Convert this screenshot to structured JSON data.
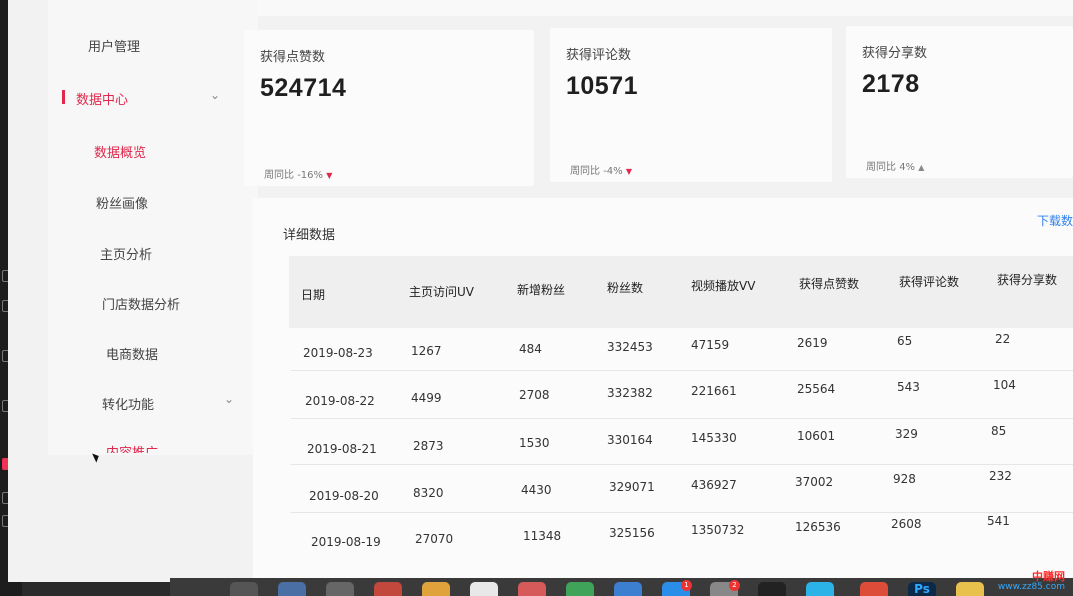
{
  "sidebar": {
    "items": [
      {
        "label": "用户管理"
      },
      {
        "label": "数据中心"
      },
      {
        "label": "数据概览"
      },
      {
        "label": "粉丝画像"
      },
      {
        "label": "主页分析"
      },
      {
        "label": "门店数据分析"
      },
      {
        "label": "电商数据"
      },
      {
        "label": "转化功能"
      },
      {
        "label": "内容推广"
      }
    ],
    "active_section": "数据中心",
    "active_item": "数据概览"
  },
  "stats": [
    {
      "label": "获得点赞数",
      "value": "524714",
      "change_label": "周同比",
      "change": "-16%",
      "direction": "down"
    },
    {
      "label": "获得评论数",
      "value": "10571",
      "change_label": "周同比",
      "change": "-4%",
      "direction": "down"
    },
    {
      "label": "获得分享数",
      "value": "2178",
      "change_label": "周同比",
      "change": "4%",
      "direction": "up"
    }
  ],
  "detail": {
    "title": "详细数据",
    "download_label": "下载数",
    "columns": [
      "日期",
      "主页访问UV",
      "新增粉丝",
      "粉丝数",
      "视频播放VV",
      "获得点赞数",
      "获得评论数",
      "获得分享数"
    ],
    "rows": [
      [
        "2019-08-23",
        "1267",
        "484",
        "332453",
        "47159",
        "2619",
        "65",
        "22"
      ],
      [
        "2019-08-22",
        "4499",
        "2708",
        "332382",
        "221661",
        "25564",
        "543",
        "104"
      ],
      [
        "2019-08-21",
        "2873",
        "1530",
        "330164",
        "145330",
        "10601",
        "329",
        "85"
      ],
      [
        "2019-08-20",
        "8320",
        "4430",
        "329071",
        "436927",
        "37002",
        "928",
        "232"
      ],
      [
        "2019-08-19",
        "27070",
        "11348",
        "325156",
        "1350732",
        "126536",
        "2608",
        "541"
      ]
    ]
  },
  "dock": {
    "badges": [
      "1",
      "2"
    ],
    "ps_label": "Ps"
  },
  "watermark": {
    "brand": "中赚网",
    "url": "www.zz85.com"
  },
  "colors": {
    "accent": "#e0284c",
    "link": "#2f80ed"
  }
}
